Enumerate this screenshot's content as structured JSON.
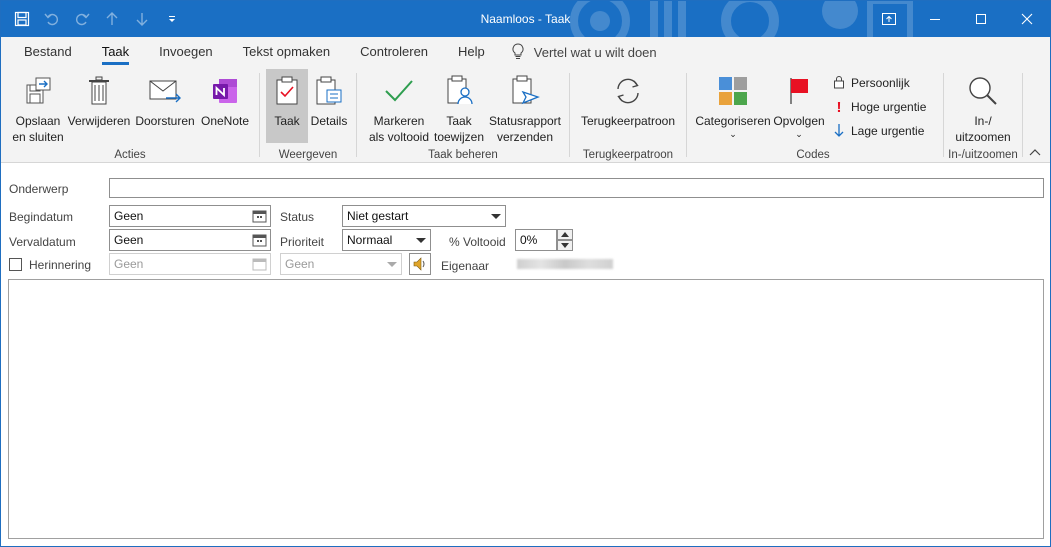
{
  "window": {
    "title": "Naamloos  -  Taak"
  },
  "tabs": [
    {
      "label": "Bestand"
    },
    {
      "label": "Taak"
    },
    {
      "label": "Invoegen"
    },
    {
      "label": "Tekst opmaken"
    },
    {
      "label": "Controleren"
    },
    {
      "label": "Help"
    }
  ],
  "tellme": {
    "label": "Vertel wat u wilt doen"
  },
  "ribbon": {
    "acties": {
      "label": "Acties",
      "save_line1": "Opslaan",
      "save_line2": "en sluiten",
      "delete": "Verwijderen",
      "forward": "Doorsturen",
      "onenote": "OneNote"
    },
    "weergeven": {
      "label": "Weergeven",
      "taak": "Taak",
      "details": "Details"
    },
    "taakbeheren": {
      "label": "Taak beheren",
      "mark_line1": "Markeren",
      "mark_line2": "als voltooid",
      "assign_line1": "Taak",
      "assign_line2": "toewijzen",
      "report_line1": "Statusrapport",
      "report_line2": "verzenden"
    },
    "terugkeer": {
      "label": "Terugkeerpatroon",
      "button": "Terugkeerpatroon"
    },
    "codes": {
      "label": "Codes",
      "categorize": "Categoriseren",
      "followup": "Opvolgen",
      "private": "Persoonlijk",
      "high": "Hoge urgentie",
      "low": "Lage urgentie"
    },
    "zoom": {
      "label": "In-/uitzoomen",
      "line1": "In-/",
      "line2": "uitzoomen"
    }
  },
  "form": {
    "subject_label": "Onderwerp",
    "subject_value": "",
    "start_label": "Begindatum",
    "start_value": "Geen",
    "due_label": "Vervaldatum",
    "due_value": "Geen",
    "reminder_label": "Herinnering",
    "reminder_date": "Geen",
    "reminder_time": "Geen",
    "status_label": "Status",
    "status_value": "Niet gestart",
    "priority_label": "Prioriteit",
    "priority_value": "Normaal",
    "complete_label": "% Voltooid",
    "complete_value": "0%",
    "owner_label": "Eigenaar"
  },
  "colors": {
    "titlebar": "#1a6fc4",
    "accent": "#1a6fc4",
    "onenote": "#7719aa",
    "check_green": "#2e9e4f",
    "urgent_red": "#e81123"
  }
}
